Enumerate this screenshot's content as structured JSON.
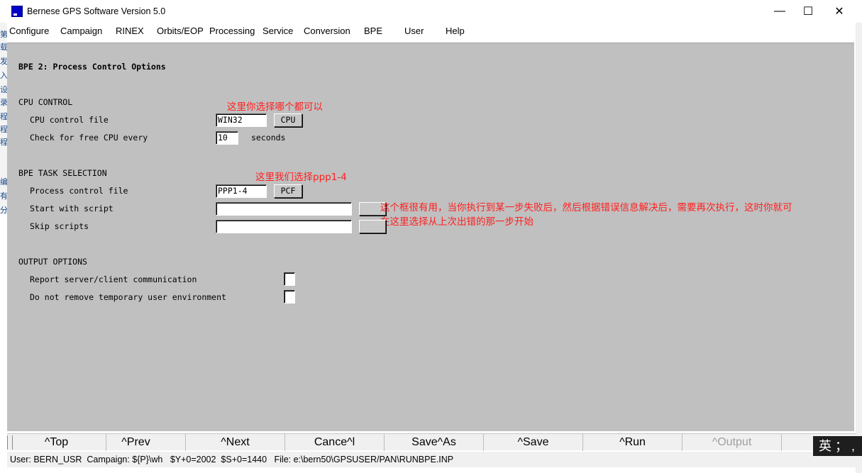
{
  "window": {
    "title": "Bernese GPS Software Version 5.0",
    "minimize_glyph": "—",
    "maximize_glyph": "☐",
    "close_glyph": "✕"
  },
  "background_strip": [
    "第",
    "载",
    "发",
    "入",
    "设",
    "录",
    "程",
    "程",
    "程",
    "编",
    "有",
    "分"
  ],
  "menu": [
    "Configure",
    "Campaign",
    "RINEX",
    "Orbits/EOP",
    "Processing",
    "Service",
    "Conversion",
    "BPE",
    "User",
    "Help"
  ],
  "panel": {
    "heading": "BPE 2: Process Control Options",
    "cpu_section": {
      "title": "CPU CONTROL",
      "cpu_file_label": "CPU control file",
      "cpu_file_value": "WIN32",
      "cpu_button": "CPU",
      "check_label": "Check for free CPU every",
      "check_value": "10",
      "check_unit": "seconds",
      "annotation": "这里你选择哪个都可以"
    },
    "task_section": {
      "title": "BPE TASK SELECTION",
      "pcf_label": "Process control file",
      "pcf_value": "PPP1-4",
      "pcf_button": "PCF",
      "start_label": "Start with script",
      "start_value": "",
      "skip_label": "Skip scripts",
      "skip_value": "",
      "annotation_pcf": "这里我们选择ppp1-4",
      "annotation_start_line1": "这个框很有用，当你执行到某一步失败后，然后根据错误信息解决后，需要再次执行，这时你就可",
      "annotation_start_line2": "在这里选择从上次出错的那一步开始"
    },
    "output_section": {
      "title": "OUTPUT OPTIONS",
      "report_label": "Report server/client communication",
      "report_checked": false,
      "noremove_label": "Do not remove temporary user environment",
      "noremove_checked": false
    }
  },
  "toolbar": [
    "^Top",
    "^Prev",
    "^Next",
    "Cance^l",
    "Save^As",
    "^Save",
    "^Run",
    "^Output"
  ],
  "toolbar_disabled": [
    "^Output"
  ],
  "status": {
    "user": "User: BERN_USR",
    "campaign": "Campaign: ${P}\\wh",
    "year": "$Y+0=2002",
    "session": "$S+0=1440",
    "file": "File: e:\\bern50\\GPSUSER/PAN\\RUNBPE.INP"
  },
  "ime": "英 ； ,"
}
